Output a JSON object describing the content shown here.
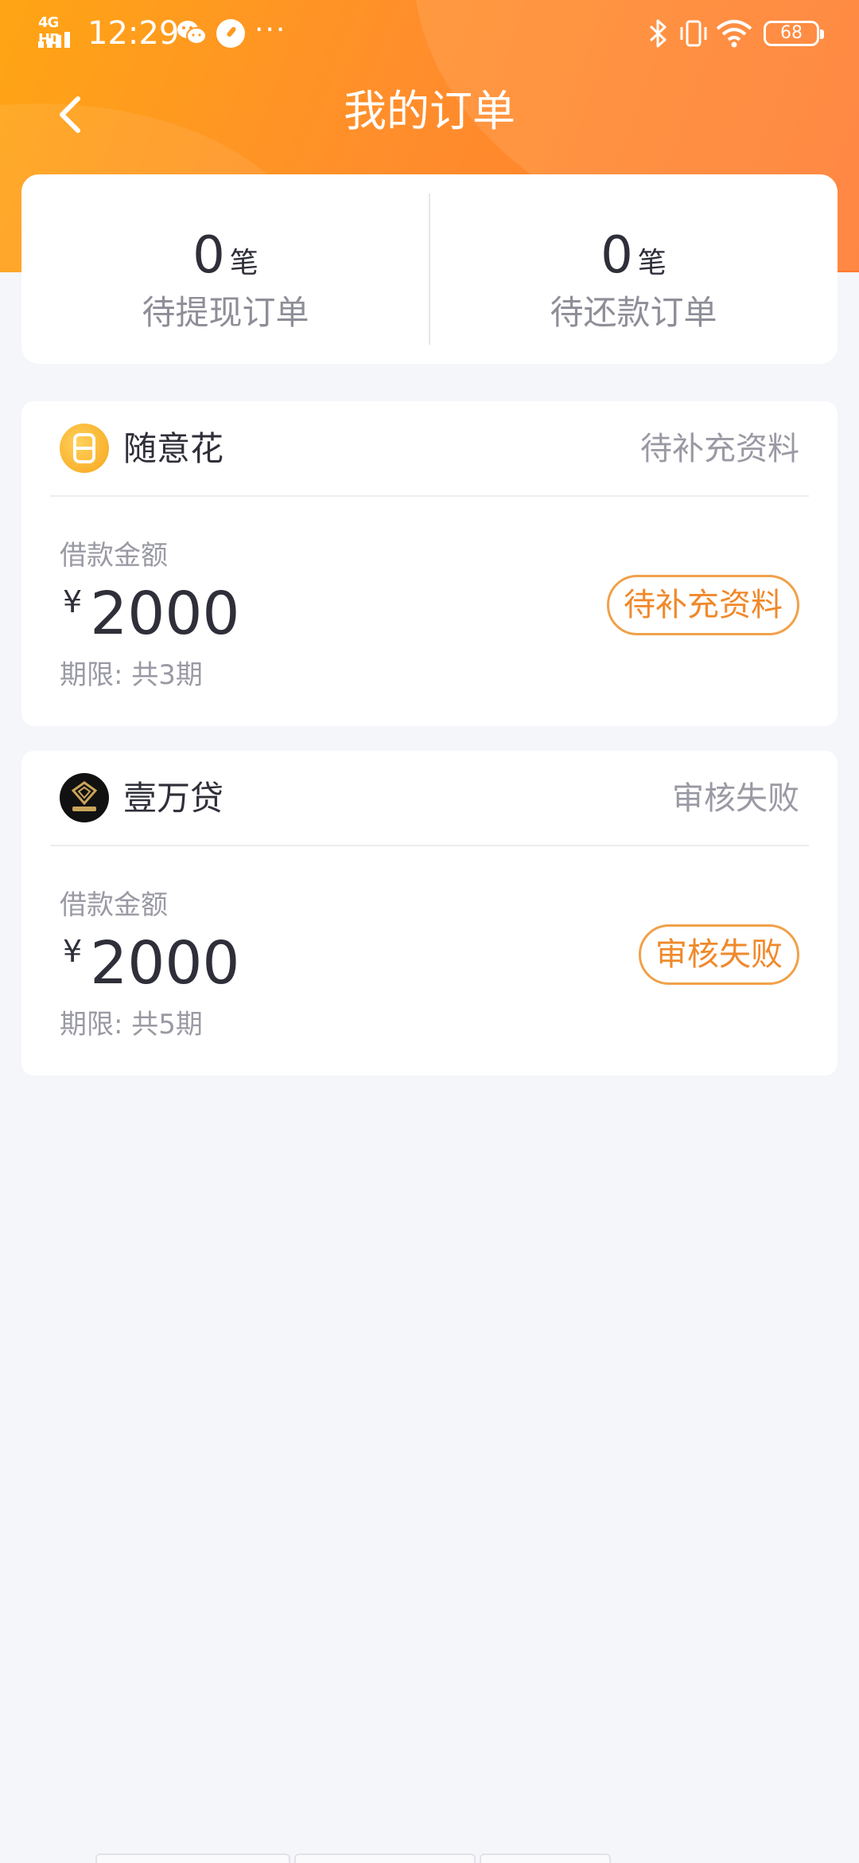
{
  "status_bar": {
    "network": "4G HD",
    "time": "12:29",
    "more": "···",
    "battery": "68"
  },
  "header": {
    "title": "我的订单"
  },
  "summary": {
    "left": {
      "count": "0",
      "unit": "笔",
      "label": "待提现订单"
    },
    "right": {
      "count": "0",
      "unit": "笔",
      "label": "待还款订单"
    }
  },
  "orders": [
    {
      "brand": "随意花",
      "status": "待补充资料",
      "loan_label": "借款金额",
      "currency": "¥",
      "amount": "2000",
      "term": "期限: 共3期",
      "action": "待补充资料"
    },
    {
      "brand": "壹万贷",
      "status": "审核失败",
      "loan_label": "借款金额",
      "currency": "¥",
      "amount": "2000",
      "term": "期限: 共5期",
      "action": "审核失败"
    }
  ],
  "colors": {
    "header_gradient_start": "#ffa514",
    "header_gradient_end": "#ff7a2f",
    "accent": "#f0892a",
    "background": "#f5f6fa"
  }
}
